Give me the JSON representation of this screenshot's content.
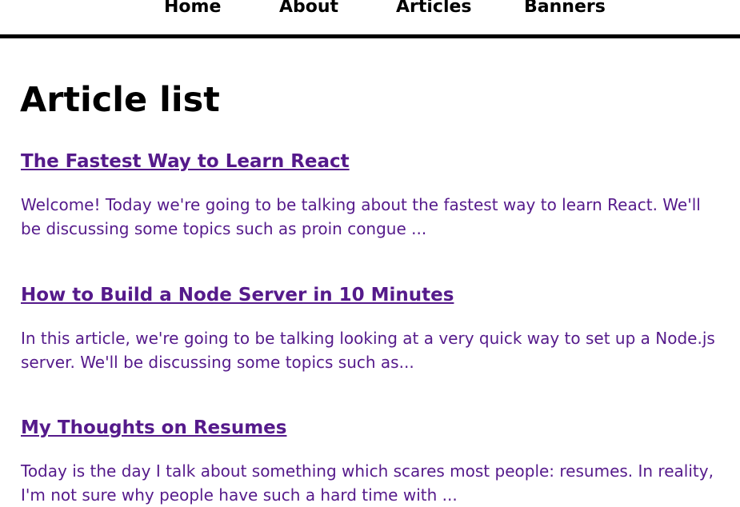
{
  "nav": {
    "items": [
      {
        "label": "Home"
      },
      {
        "label": "About"
      },
      {
        "label": "Articles"
      },
      {
        "label": "Banners"
      }
    ]
  },
  "page": {
    "title": "Article list"
  },
  "articles": [
    {
      "title": "The Fastest Way to Learn React",
      "excerpt": "Welcome! Today we're going to be talking about the fastest way to learn React. We'll be discussing some topics such as proin congue ..."
    },
    {
      "title": "How to Build a Node Server in 10 Minutes",
      "excerpt": "In this article, we're going to be talking looking at a very quick way to set up a Node.js server. We'll be discussing some topics such as..."
    },
    {
      "title": "My Thoughts on Resumes",
      "excerpt": "Today is the day I talk about something which scares most people: resumes. In reality, I'm not sure why people have such a hard time with ..."
    }
  ],
  "colors": {
    "link": "#551a8b",
    "text": "#000000",
    "background": "#ffffff"
  }
}
